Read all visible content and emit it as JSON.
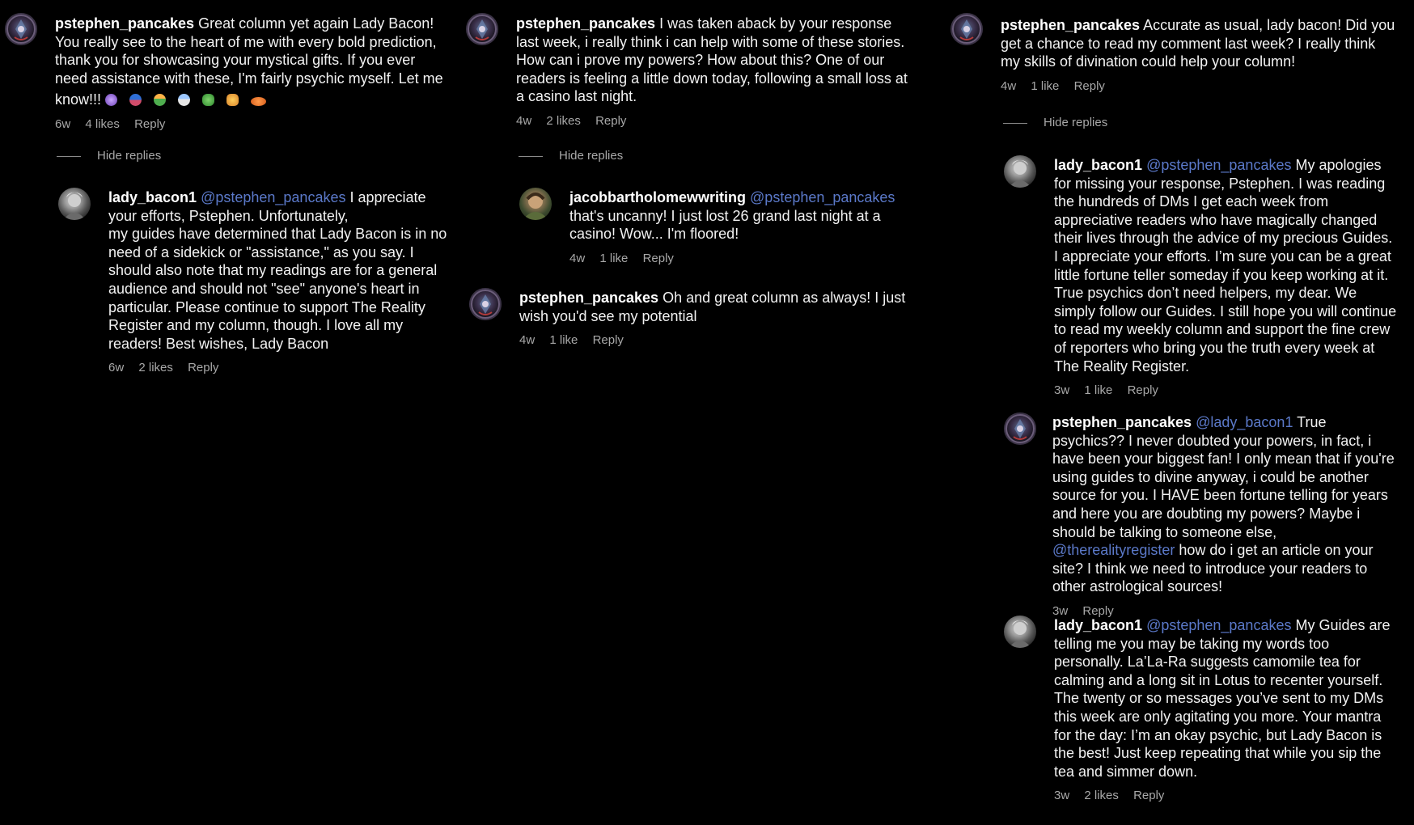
{
  "columns": [
    {
      "comments": [
        {
          "username": "pstephen_pancakes",
          "text": "Great column yet again Lady Bacon! You really see to the heart of me with every bold prediction, thank you for showcasing your mystical gifts. If you ever need assistance with these, I'm fairly psychic myself. Let me know!!!",
          "emoji_icons": [
            "crystal-ball",
            "mage",
            "elf",
            "mage-2",
            "dragon",
            "amphora",
            "ringed-planet"
          ],
          "time": "6w",
          "likes": "4 likes",
          "reply": "Reply"
        }
      ],
      "hide_replies": "Hide replies",
      "replies": [
        {
          "username": "lady_bacon1",
          "mention": "@pstephen_pancakes",
          "text_line1": "I appreciate your efforts, Pstephen. Unfortunately,",
          "text_line2": "my guides have determined that Lady Bacon is in no need of a sidekick or \"assistance,\" as you say. I should also note that my readings are for a general audience and should not \"see\" anyone's heart in particular. Please continue to support The Reality Register and my column, though. I love all my readers! Best wishes, Lady Bacon",
          "time": "6w",
          "likes": "2 likes",
          "reply": "Reply"
        }
      ]
    },
    {
      "comments": [
        {
          "username": "pstephen_pancakes",
          "text": "I was taken aback by your response last week, i really think i can help with some of these stories. How can i prove my powers? How about this? One of our readers is feeling a little down today, following a small loss at a casino last night.",
          "time": "4w",
          "likes": "2 likes",
          "reply": "Reply"
        }
      ],
      "hide_replies": "Hide replies",
      "replies": [
        {
          "username": "jacobbartholomewwriting",
          "mention": "@pstephen_pancakes",
          "text": "that's uncanny! I just lost 26 grand last night at a casino! Wow... I'm floored!",
          "time": "4w",
          "likes": "1 like",
          "reply": "Reply"
        }
      ],
      "after": {
        "username": "pstephen_pancakes",
        "text": "Oh and great column as always! I just wish you'd see my potential",
        "time": "4w",
        "likes": "1 like",
        "reply": "Reply"
      }
    },
    {
      "comments": [
        {
          "username": "pstephen_pancakes",
          "text": "Accurate as usual, lady bacon! Did you get a chance to read my comment last week? I really think my skills of divination could help your column!",
          "time": "4w",
          "likes": "1 like",
          "reply": "Reply"
        }
      ],
      "hide_replies": "Hide replies",
      "replies": [
        {
          "username": "lady_bacon1",
          "mention": "@pstephen_pancakes",
          "text": "My apologies for missing your response, Pstephen. I was reading the hundreds of DMs I get each week from appreciative readers who have magically changed their lives through the advice of my precious Guides. I appreciate your efforts. I’m sure you can be a great little fortune teller someday if you keep working at it. True psychics don’t need helpers, my dear. We simply follow our Guides. I still hope you will continue to read my weekly column and support the fine crew of reporters who bring you the truth every week at The Reality Register.",
          "time": "3w",
          "likes": "1 like",
          "reply": "Reply"
        },
        {
          "username": "pstephen_pancakes",
          "mention": "@lady_bacon1",
          "text_a": "True psychics?? I never doubted your powers, in fact, i have been your biggest fan! I only mean that if you're using guides to divine anyway, i could be another source for you. I HAVE been fortune telling for years and here you are doubting my powers? Maybe i should be talking to someone else,",
          "mention2": "@therealityregister",
          "text_b": "how do i get an article on your site? I think we need to introduce your readers to other astrological sources!",
          "time": "3w",
          "reply": "Reply"
        },
        {
          "username": "lady_bacon1",
          "mention": "@pstephen_pancakes",
          "text": "My Guides are telling me you may be taking my words too personally. La’La-Ra suggests camomile tea for calming and a long sit in Lotus to recenter yourself. The twenty or so messages you’ve sent to my DMs this week are only agitating you more. Your mantra for the day: I’m an okay psychic, but Lady Bacon is the best! Just keep repeating that while you sip the tea and simmer down.",
          "time": "3w",
          "likes": "2 likes",
          "reply": "Reply"
        }
      ]
    }
  ]
}
